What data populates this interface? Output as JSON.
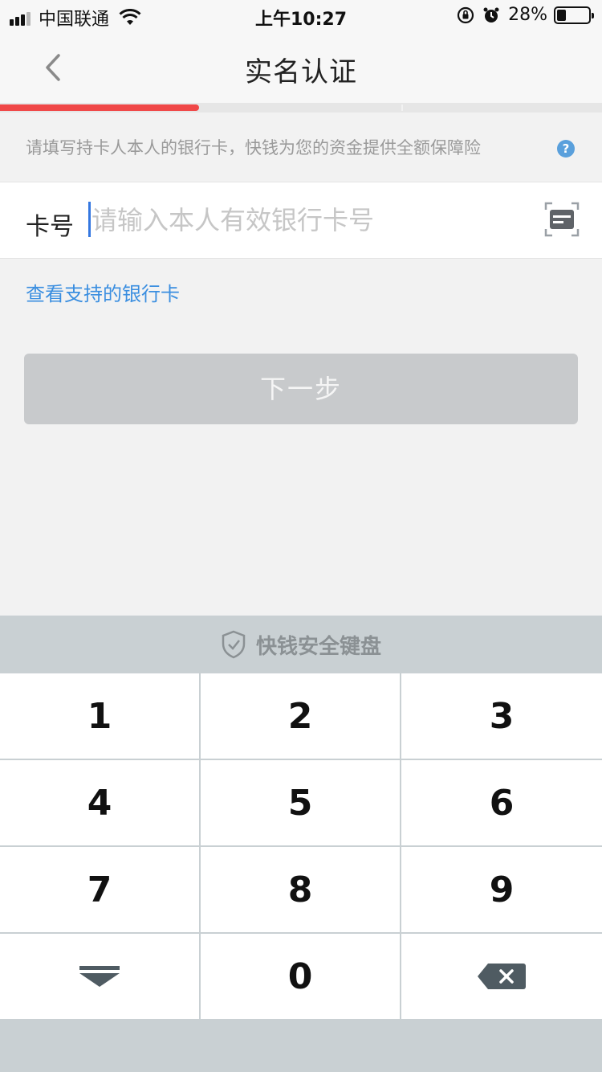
{
  "status_bar": {
    "carrier": "中国联通",
    "time": "上午10:27",
    "battery": "28%",
    "battery_level": 0.28
  },
  "nav": {
    "title": "实名认证",
    "back_icon": "chevron-left-icon"
  },
  "progress": {
    "value": 0.33
  },
  "notice": {
    "text": "请填写持卡人本人的银行卡，快钱为您的资金提供全额保障险",
    "help_icon_text": "?"
  },
  "card_field": {
    "label": "卡号",
    "placeholder": "请输入本人有效银行卡号",
    "value": "",
    "scan_icon": "card-scan-icon"
  },
  "support_link": "查看支持的银行卡",
  "next_button": "下一步",
  "keyboard": {
    "title": "快钱安全键盘",
    "keys": [
      "1",
      "2",
      "3",
      "4",
      "5",
      "6",
      "7",
      "8",
      "9",
      "",
      "0",
      ""
    ],
    "hide_icon": "keyboard-hide-icon",
    "delete_icon": "backspace-icon"
  },
  "colors": {
    "accent": "#f04848",
    "link": "#3a8ee0",
    "cursor": "#3477e0",
    "disabled_button": "#c8cacc",
    "keyboard_bg": "#c9d0d3"
  }
}
